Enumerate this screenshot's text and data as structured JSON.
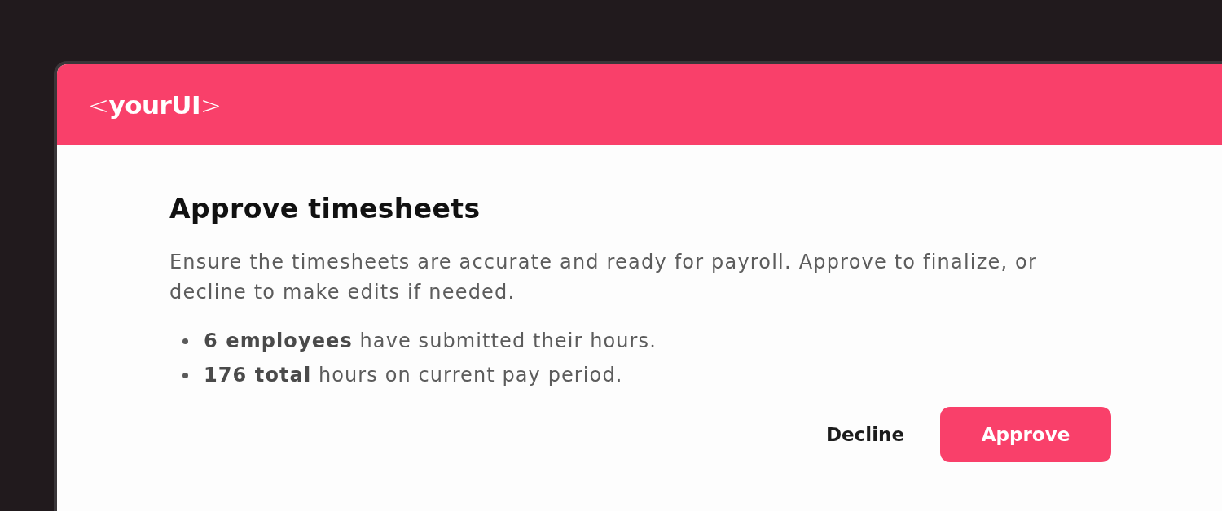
{
  "header": {
    "logo": "<**yourUI**>"
  },
  "dialog": {
    "title": "Approve timesheets",
    "description": "Ensure the timesheets are accurate and ready for payroll. Approve to finalize, or decline to make edits if needed.",
    "bullets": [
      "**6 employees** have submitted their hours.",
      "**176 total** hours on current pay period."
    ]
  },
  "actions": [
    {
      "label": "Decline",
      "kind": "secondary"
    },
    {
      "label": "Approve",
      "kind": "primary"
    }
  ]
}
